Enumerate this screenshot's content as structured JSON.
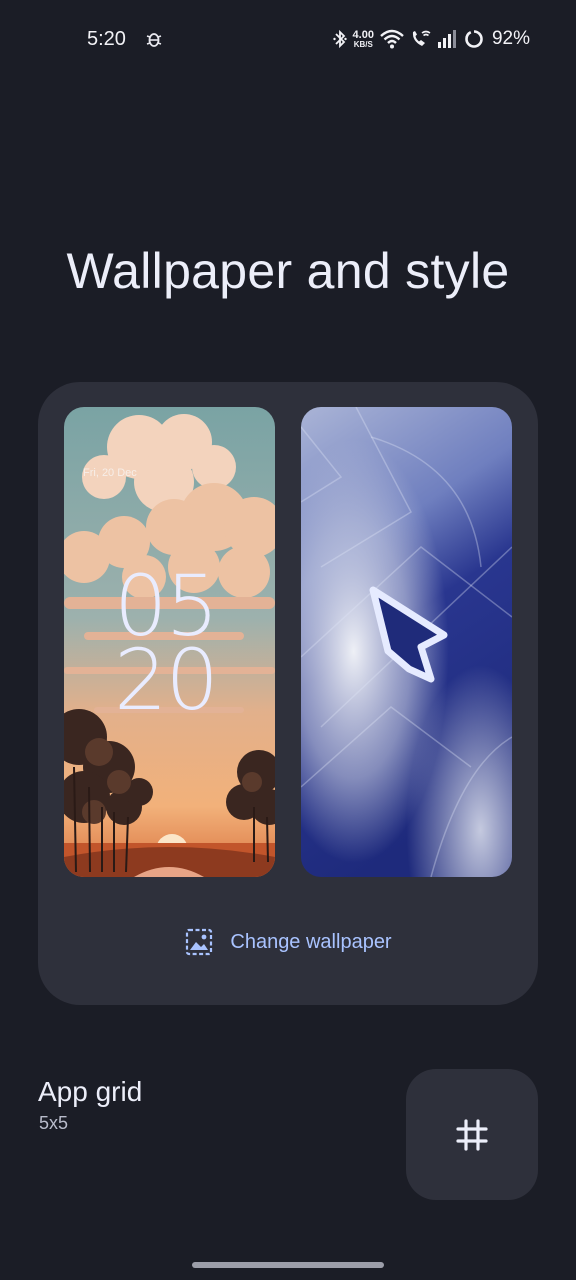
{
  "status_bar": {
    "time": "5:20",
    "net_speed_value": "4.00",
    "net_speed_unit": "KB/S",
    "battery_percent": "92%",
    "icons": [
      "debug-icon",
      "bluetooth-icon",
      "wifi-icon",
      "wifi-call-icon",
      "signal-icon",
      "battery-icon"
    ]
  },
  "page": {
    "title": "Wallpaper and style"
  },
  "wallpaper": {
    "lock_date": "Fri, 20 Dec",
    "lock_hour": "05",
    "lock_minute": "20",
    "change_label": "Change wallpaper",
    "change_icon": "image-icon",
    "accent": "#a9c3ff"
  },
  "app_grid": {
    "title": "App grid",
    "value": "5x5",
    "icon": "grid-icon"
  },
  "colors": {
    "background": "#1b1d26",
    "card": "#2e303b"
  }
}
